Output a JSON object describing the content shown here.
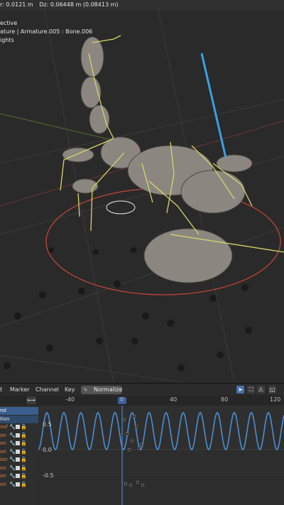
{
  "viewport": {
    "header_readout": [
      "r: 0.0121 m",
      "Dz: 0.06448 m (0.08413 m)"
    ],
    "overlay_lines": [
      "ective",
      "ature | Armature.005 : Bone.006",
      "ights"
    ]
  },
  "graph_editor": {
    "menus": [
      "t",
      "Marker",
      "Channel",
      "Key"
    ],
    "normalize_label": "Normalize",
    "normalize_icon": "normalize-curve-icon",
    "header_icons": [
      "cursor-icon",
      "fit-view-icon",
      "warning-icon",
      "frame-icon"
    ],
    "ruler_ticks": [
      "-40",
      "0",
      "40",
      "80",
      "120"
    ],
    "y_labels": [
      "0.5",
      "0.0",
      "-0.5"
    ],
    "channels": [
      {
        "name": "rol",
        "style": "sel"
      },
      {
        "name": "tion",
        "style": "obj"
      },
      {
        "name": "nsf",
        "style": "normal"
      },
      {
        "name": "on",
        "style": "normal"
      },
      {
        "name": "on",
        "style": "normal"
      },
      {
        "name": "on",
        "style": "normal"
      },
      {
        "name": "ion",
        "style": "normal"
      },
      {
        "name": "on",
        "style": "normal"
      },
      {
        "name": "on",
        "style": "normal"
      },
      {
        "name": "on",
        "style": "normal"
      }
    ],
    "colors": {
      "curve": "#4a8fd6",
      "playhead": "#5a8cd0",
      "selected_channel": "#3a5f8f"
    }
  }
}
